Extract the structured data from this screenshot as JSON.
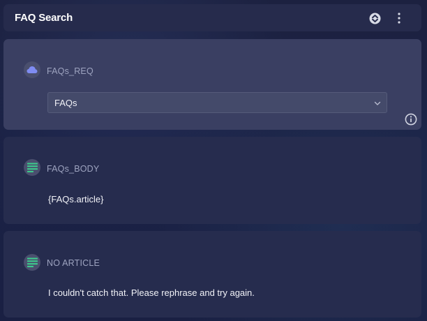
{
  "header": {
    "title": "FAQ Search",
    "collapse_icon": "collapse-circle-icon",
    "menu_icon": "more-vertical-icon"
  },
  "nodes": {
    "request": {
      "icon": "cloud-icon",
      "icon_color": "#7f8cf2",
      "label": "FAQs_REQ",
      "select_value": "FAQs",
      "info_icon": "info-icon"
    },
    "body": {
      "icon": "text-lines-icon",
      "icon_color": "#3ccf8e",
      "label": "FAQs_BODY",
      "text": "{FAQs.article}"
    },
    "no_article": {
      "icon": "text-lines-icon",
      "icon_color": "#3ccf8e",
      "label": "NO ARTICLE",
      "text": "I couldn't catch that. Please rephrase and try again."
    }
  },
  "colors": {
    "background": "#1b2145",
    "header_bg": "#262b4c",
    "active_card_bg": "#3a3f62",
    "card_bg": "#262c4e",
    "label_text": "#9ea4c0"
  }
}
